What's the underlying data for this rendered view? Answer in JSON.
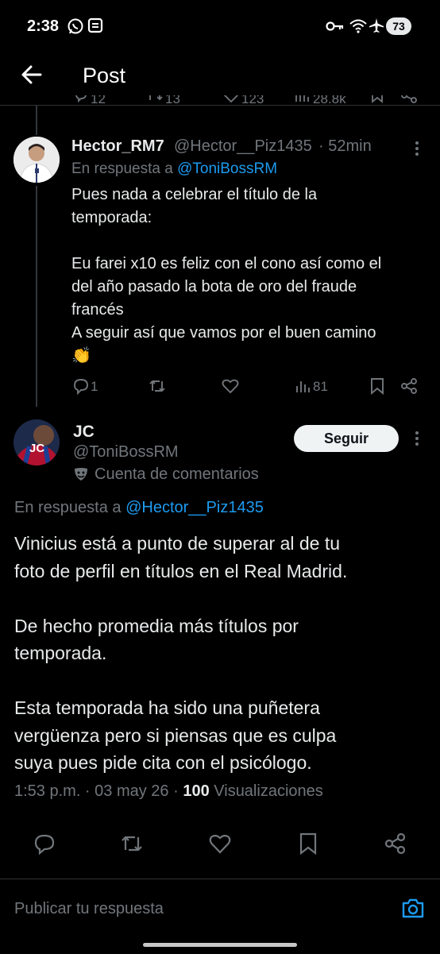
{
  "status_bar": {
    "time": "2:38",
    "battery": "73"
  },
  "header": {
    "title": "Post"
  },
  "prev_actions": {
    "replies": "12",
    "reposts": "13",
    "likes": "123",
    "views": "28.8k"
  },
  "reply_tweet": {
    "display_name": "Hector_RM7",
    "handle": "@Hector__Piz1435",
    "time": "· 52min",
    "reply_prefix": "En respuesta a",
    "reply_to": "@ToniBossRM",
    "lines": [
      "Pues nada a celebrar el título de la",
      "temporada:",
      "",
      "Eu farei x10 es feliz con el cono así como el",
      "del año pasado la bota de oro del fraude",
      "francés",
      "A seguir así que vamos por el buen camino",
      "👏"
    ],
    "replies": "1",
    "views": "81"
  },
  "main_tweet": {
    "display_name": "JC",
    "avatar_text": "JC",
    "handle": "@ToniBossRM",
    "follow_label": "Seguir",
    "account_label": "Cuenta de comentarios",
    "reply_prefix": "En respuesta a",
    "reply_to": "@Hector__Piz1435",
    "lines": [
      "Vinicius está a punto de superar al de tu",
      "foto de perfil en títulos en el Real Madrid.",
      "",
      "De hecho promedia más títulos por",
      "temporada.",
      "",
      "Esta temporada ha sido una puñetera",
      "vergüenza pero si piensas que es culpa",
      "suya pues pide cita con el psicólogo."
    ],
    "timestamp": "1:53 p.m. · 03 may 26 ·",
    "view_count": "100",
    "view_label": "Visualizaciones"
  },
  "composer": {
    "placeholder": "Publicar tu respuesta"
  },
  "colors": {
    "accent": "#1d9bf0",
    "muted": "#71767b",
    "background": "#000000"
  }
}
